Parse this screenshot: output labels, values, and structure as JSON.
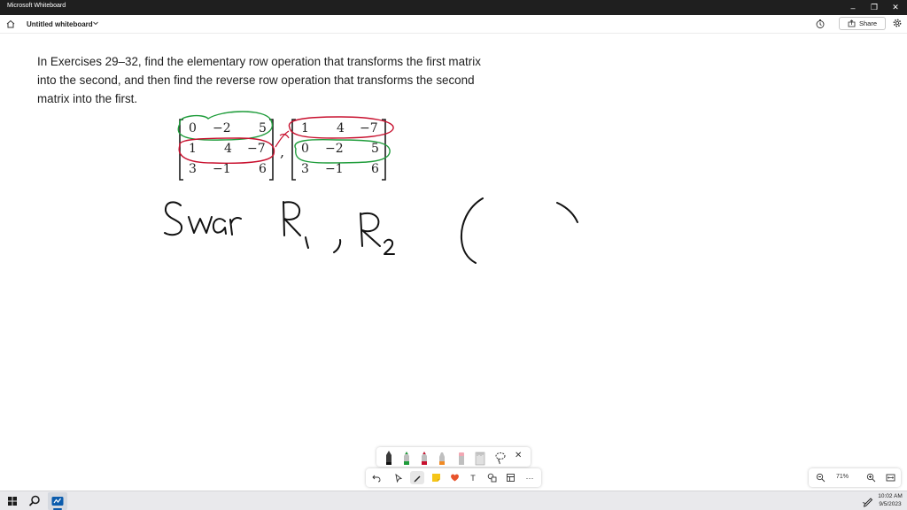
{
  "window": {
    "app_title": "Microsoft Whiteboard",
    "minimize_glyph": "–",
    "restore_glyph": "❐",
    "close_glyph": "✕"
  },
  "header": {
    "board_title": "Untitled whiteboard",
    "share_label": "Share"
  },
  "problem": {
    "lines": [
      "In Exercises 29–32, find the elementary row operation that transforms the first matrix",
      "into the second, and then find the reverse row operation that transforms the second",
      "matrix into the first."
    ]
  },
  "matrix_a": [
    [
      "0",
      "−2",
      "5"
    ],
    [
      "1",
      "4",
      "−7"
    ],
    [
      "3",
      "−1",
      "6"
    ]
  ],
  "matrix_b": [
    [
      "1",
      "4",
      "−7"
    ],
    [
      "0",
      "−2",
      "5"
    ],
    [
      "3",
      "−1",
      "6"
    ]
  ],
  "matrix_separator": ",",
  "ink": {
    "red_color": "#c8102e",
    "green_color": "#1e9c3a",
    "black_color": "#111111"
  },
  "toolbar": {
    "more_glyph": "···",
    "text_glyph": "T"
  },
  "pen_tray": {
    "close_glyph": "✕"
  },
  "zoom": {
    "level": "71%"
  },
  "taskbar": {
    "time": "10:02 AM",
    "date": "9/5/2023"
  }
}
